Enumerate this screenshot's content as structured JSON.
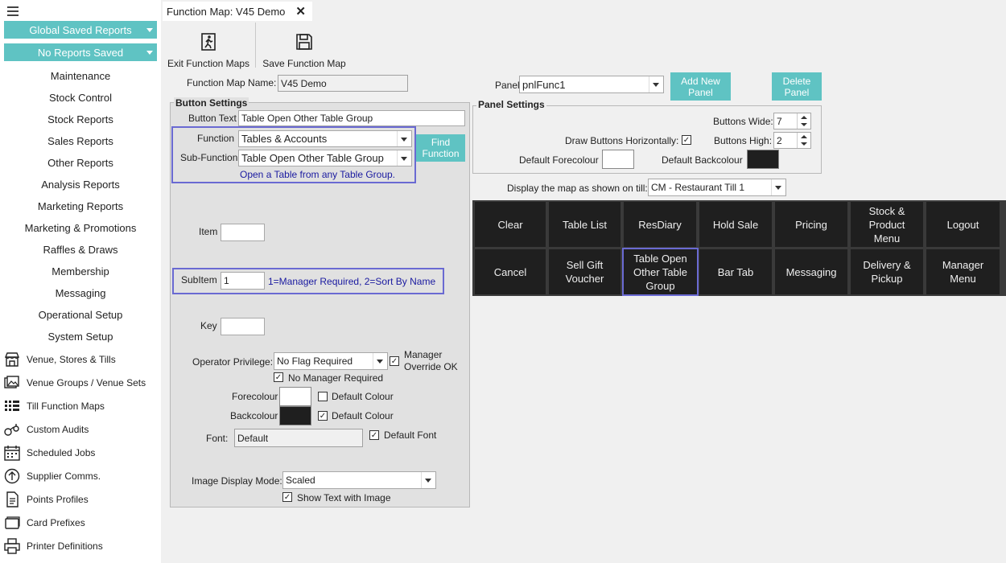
{
  "sidebar": {
    "global_saved_reports": "Global Saved Reports",
    "no_reports_saved": "No Reports Saved",
    "menu_items": [
      "Maintenance",
      "Stock Control",
      "Stock Reports",
      "Sales Reports",
      "Other Reports",
      "Analysis Reports",
      "Marketing Reports",
      "Marketing & Promotions",
      "Raffles & Draws",
      "Membership",
      "Messaging",
      "Operational Setup",
      "System Setup"
    ],
    "icon_items": [
      "Venue, Stores & Tills",
      "Venue Groups / Venue Sets",
      "Till Function Maps",
      "Custom Audits",
      "Scheduled Jobs",
      "Supplier Comms.",
      "Points Profiles",
      "Card Prefixes",
      "Printer Definitions"
    ]
  },
  "tab": {
    "title": "Function Map: V45 Demo"
  },
  "toolbar": {
    "exit": "Exit Function Maps",
    "save": "Save Function Map"
  },
  "function_map_name": {
    "label": "Function Map Name:",
    "value": "V45 Demo"
  },
  "button_settings": {
    "title": "Button Settings",
    "button_text_label": "Button Text",
    "button_text_value": "Table Open Other Table Group",
    "function_label": "Function",
    "function_value": "Tables & Accounts",
    "sub_function_label": "Sub-Function",
    "sub_function_value": "Table Open Other Table Group",
    "find_function": "Find Function",
    "description": "Open a Table from any Table Group.",
    "item_label": "Item",
    "item_value": "",
    "subitem_label": "SubItem",
    "subitem_value": "1",
    "subitem_hint": "1=Manager Required, 2=Sort By Name",
    "key_label": "Key",
    "key_value": "",
    "operator_privilege_label": "Operator Privilege:",
    "operator_privilege_value": "No Flag Required",
    "manager_override_label": "Manager Override OK",
    "no_manager_required_label": "No Manager Required",
    "forecolour_label": "Forecolour",
    "backcolour_label": "Backcolour",
    "default_colour_label": "Default Colour",
    "font_label": "Font:",
    "font_value": "Default",
    "default_font_label": "Default Font",
    "image_display_mode_label": "Image Display Mode:",
    "image_display_mode_value": "Scaled",
    "show_text_with_image_label": "Show Text with Image",
    "manager_override_checked": true,
    "no_manager_required_checked": true,
    "fore_default_checked": false,
    "back_default_checked": true,
    "default_font_checked": true,
    "show_text_checked": true
  },
  "panel": {
    "label": "Panel",
    "value": "pnlFunc1",
    "add_new": "Add New Panel",
    "delete": "Delete Panel",
    "settings_title": "Panel Settings",
    "buttons_wide_label": "Buttons Wide:",
    "buttons_wide_value": "7",
    "draw_horizontally_label": "Draw Buttons Horizontally:",
    "draw_horizontally_checked": true,
    "buttons_high_label": "Buttons High:",
    "buttons_high_value": "2",
    "default_forecolour_label": "Default Forecolour",
    "default_backcolour_label": "Default Backcolour",
    "display_on_till_label": "Display the map as shown on till:",
    "display_on_till_value": "CM - Restaurant Till 1"
  },
  "till_buttons": [
    [
      "Clear",
      "Table List",
      "ResDiary",
      "Hold Sale",
      "Pricing",
      "Stock & Product Menu",
      "Logout"
    ],
    [
      "Cancel",
      "Sell Gift Voucher",
      "Table Open Other Table Group",
      "Bar Tab",
      "Messaging",
      "Delivery & Pickup",
      "Manager Menu"
    ]
  ],
  "colors": {
    "accent": "#5fc3c3",
    "highlight": "#6a6ad2",
    "till_button": "#1f1f1f"
  }
}
